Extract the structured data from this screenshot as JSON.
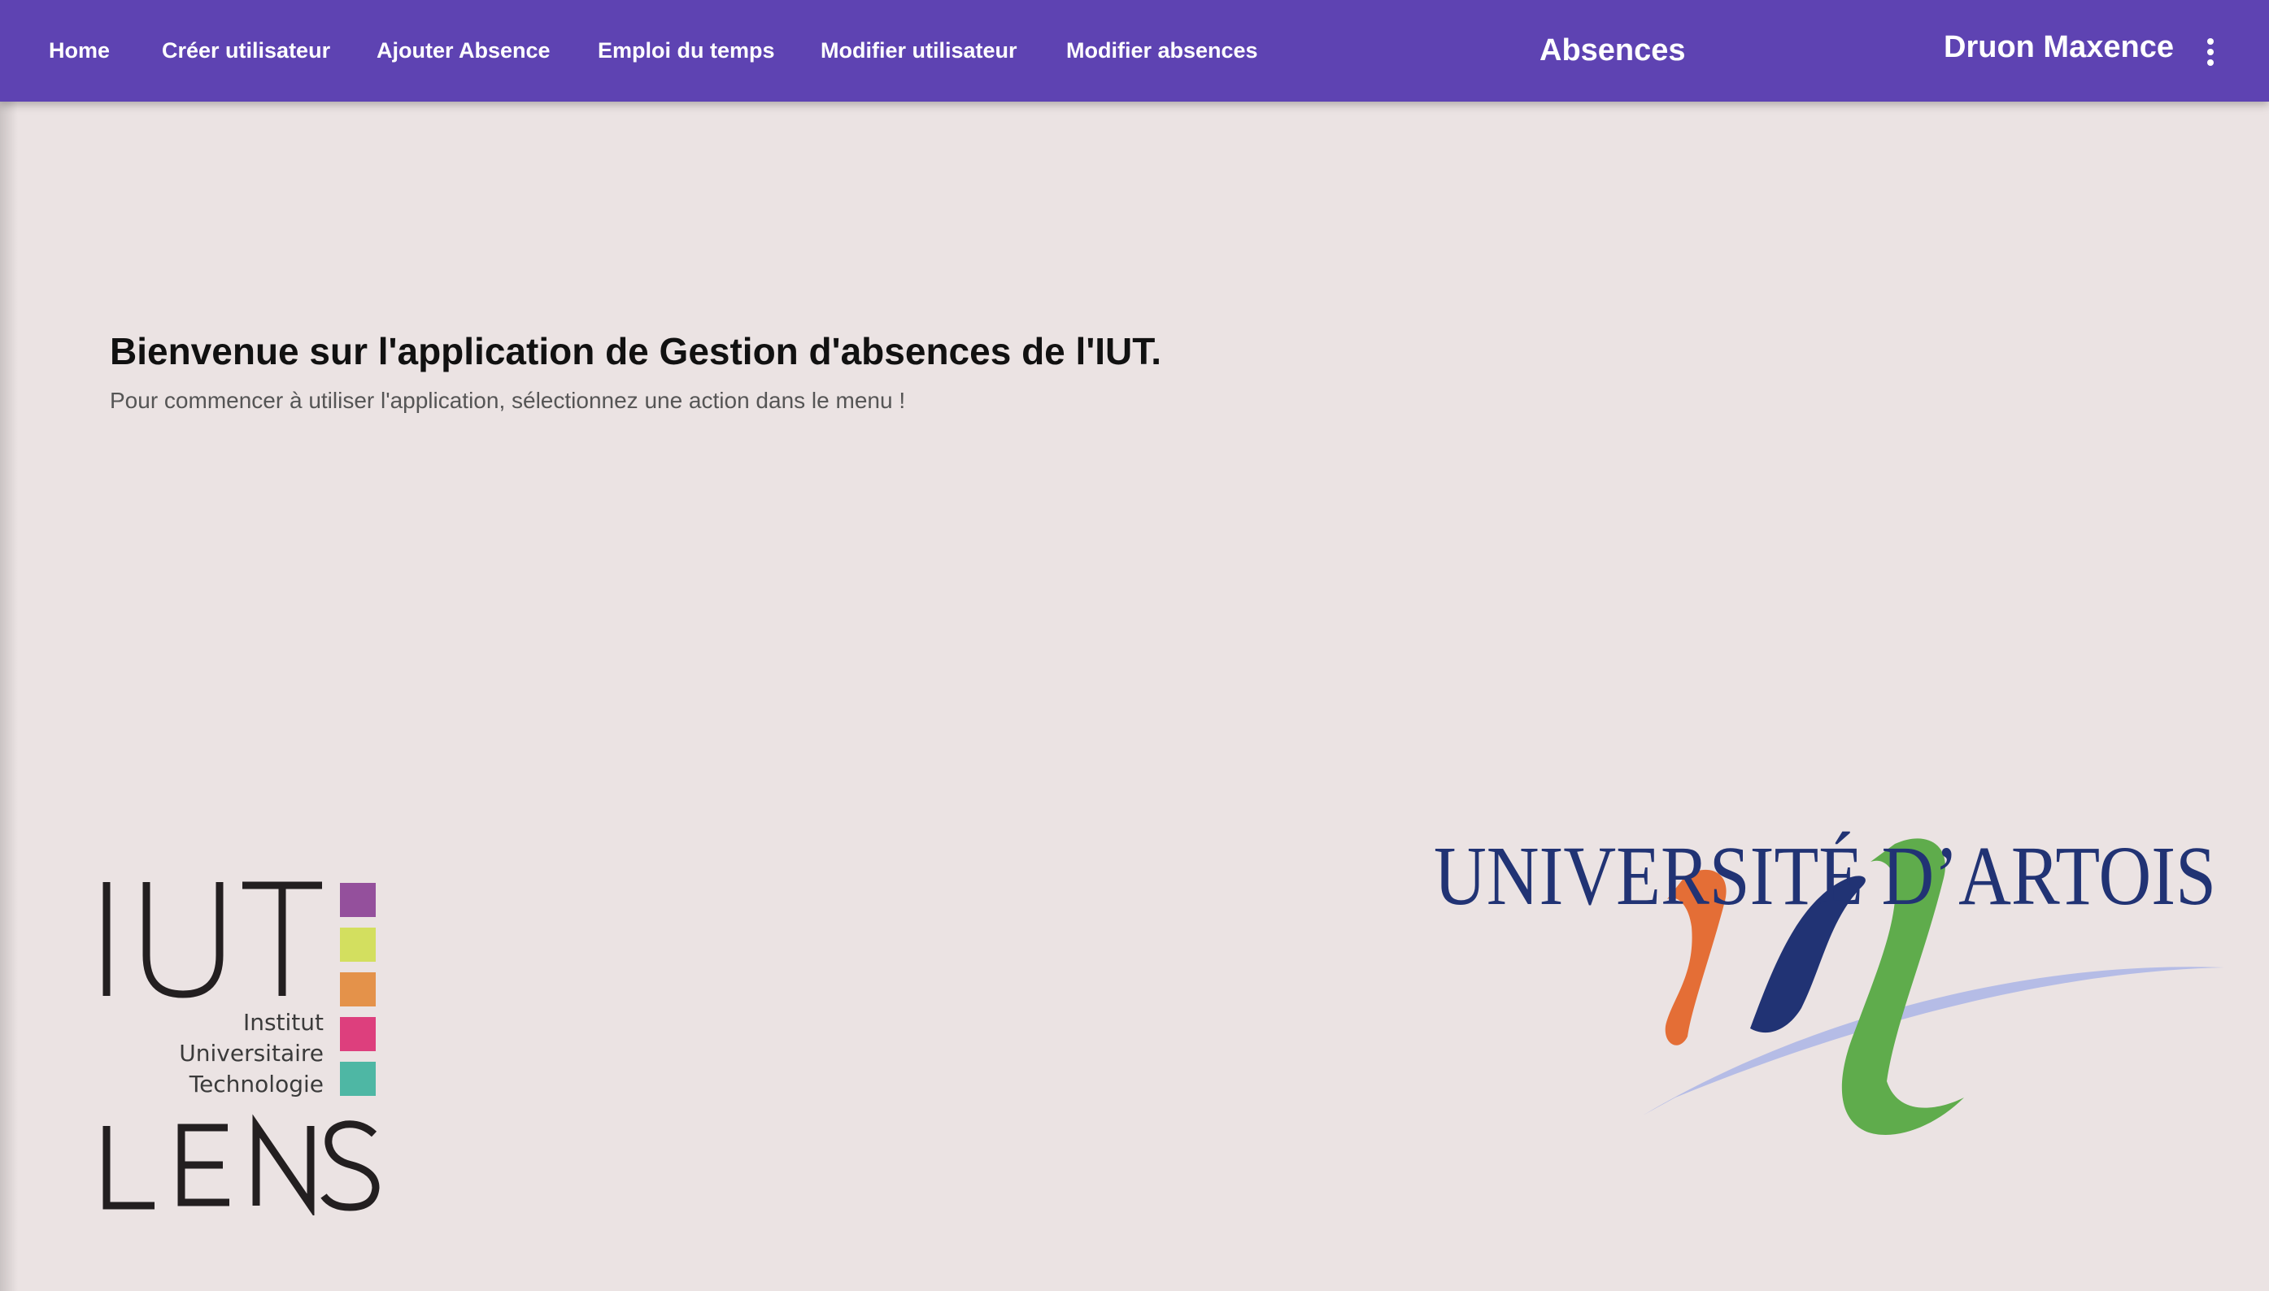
{
  "nav": {
    "items": [
      {
        "label": "Home"
      },
      {
        "label": "Créer utilisateur"
      },
      {
        "label": "Ajouter Absence"
      },
      {
        "label": "Emploi du temps"
      },
      {
        "label": "Modifier utilisateur"
      },
      {
        "label": "Modifier absences"
      }
    ],
    "title": "Absences",
    "user_name": "Druon Maxence",
    "menu_icon": "more-vert-icon"
  },
  "main": {
    "title": "Bienvenue sur l'application de Gestion d'absences de l'IUT.",
    "subtitle": "Pour commencer à utiliser l'application, sélectionnez une action dans le menu !"
  },
  "logos": {
    "iut": {
      "acronym": "IUT",
      "line1": "Institut",
      "line2": "Universitaire",
      "line3": "Technologie",
      "city": "LENS",
      "square_colors": [
        "#94509c",
        "#d3df5f",
        "#e4924a",
        "#dd3f7d",
        "#4eb7a4"
      ]
    },
    "artois": {
      "name": "UNIVERSITÉ D’ARTOIS",
      "colors": {
        "orange": "#e46e36",
        "navy": "#213374",
        "green": "#5fac4c",
        "swoosh": "#b5bce6"
      }
    }
  },
  "colors": {
    "app_bar": "#5e43b2",
    "background": "#ebe3e3"
  }
}
